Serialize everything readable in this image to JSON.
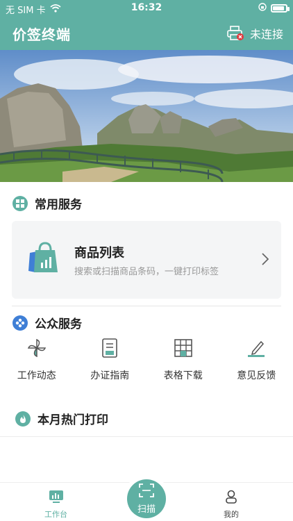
{
  "status_bar": {
    "carrier": "无 SIM 卡",
    "time": "16:32",
    "battery_level": 0.9
  },
  "header": {
    "title": "价签终端",
    "connection_status": "未连接"
  },
  "common_services": {
    "title": "常用服务",
    "card": {
      "title": "商品列表",
      "subtitle": "搜索或扫描商品条码，一键打印标签"
    }
  },
  "public_services": {
    "title": "公众服务",
    "items": [
      {
        "label": "工作动态",
        "icon": "pinwheel-icon"
      },
      {
        "label": "办证指南",
        "icon": "document-icon"
      },
      {
        "label": "表格下载",
        "icon": "table-grid-icon"
      },
      {
        "label": "意见反馈",
        "icon": "pen-icon"
      }
    ]
  },
  "hot_prints": {
    "title": "本月热门打印"
  },
  "tabbar": {
    "work_label": "工作台",
    "scan_label": "扫描",
    "me_label": "我的"
  },
  "colors": {
    "accent": "#5fb0a3",
    "danger": "#e0393e",
    "blue": "#3f7fd6"
  }
}
